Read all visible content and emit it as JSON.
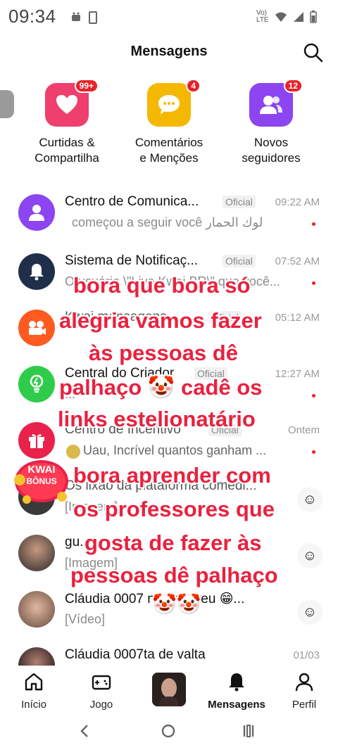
{
  "status_bar": {
    "time": "09:34",
    "network": "Vo) LTE"
  },
  "header": {
    "title": "Mensagens"
  },
  "categories": [
    {
      "label": "Curtidas & Compartilha",
      "label_line1": "Curtidas &",
      "label_line2": "Compartilha",
      "badge": "99+",
      "color": "#ee3f6e",
      "icon": "heart-icon"
    },
    {
      "label": "Comentários e Menções",
      "label_line1": "Comentários",
      "label_line2": "e Menções",
      "badge": "4",
      "color": "#f5b800",
      "icon": "chat-bubble-icon"
    },
    {
      "label": "Novos seguidores",
      "label_line1": "Novos",
      "label_line2": "seguidores",
      "badge": "12",
      "color": "#8c45f0",
      "icon": "users-icon"
    }
  ],
  "messages": [
    {
      "name": "Centro de Comunica...",
      "tag": "Oficial",
      "time": "09:22 AM",
      "preview": "começou a seguir você لوك الحمار",
      "unread": true,
      "avatar_color": "#8c45f0",
      "avatar_icon": "person-icon"
    },
    {
      "name": "Sistema de Notificaç...",
      "tag": "Oficial",
      "time": "07:52 AM",
      "preview": "O usuário \\\"Live Kwai BR\\\" que você...",
      "unread": true,
      "avatar_color": "#1f2f4a",
      "avatar_icon": "bell-icon"
    },
    {
      "name": "Kwai mensagens",
      "tag": "Oficial",
      "time": "05:12 AM",
      "preview": "",
      "unread": false,
      "avatar_color": "#ff5a1f",
      "avatar_icon": "camera-icon"
    },
    {
      "name": "Central do Criador",
      "tag": "Oficial",
      "time": "12:27 AM",
      "preview": "...",
      "unread": true,
      "avatar_color": "#2ecc4a",
      "avatar_icon": "bulb-icon"
    },
    {
      "name": "Centro de Incentivo",
      "tag": "Oficial",
      "time": "Ontem",
      "preview": "Uau, Incrível quantos ganham ...",
      "unread": true,
      "avatar_color": "#e8224a",
      "avatar_icon": "gift-icon"
    },
    {
      "name": "Os lixão da plataforma comedi...",
      "tag": "",
      "time": "",
      "preview": "[Imagem]",
      "unread": false,
      "avatar_color": "#3a3a3a",
      "avatar_icon": "photo-avatar"
    },
    {
      "name": "gu...",
      "tag": "",
      "time": "",
      "preview": "[Imagem]",
      "unread": false,
      "avatar_color": "#5a4a44",
      "avatar_icon": "photo-avatar"
    },
    {
      "name": "Cláudia 0007 não morreu 😁...",
      "tag": "",
      "time": "",
      "preview": "[Vídeo]",
      "unread": false,
      "avatar_color": "#8a6a5a",
      "avatar_icon": "photo-avatar"
    },
    {
      "name": "Cláudia 0007ta de valta",
      "tag": "",
      "time": "01/03",
      "preview": "[...]",
      "unread": false,
      "avatar_color": "#3a2a2a",
      "avatar_icon": "photo-avatar"
    }
  ],
  "overlay_text": [
    "bora que bora só",
    "alegria vamos fazer",
    "às pessoas dê",
    "palhaço 🤡 cadê os",
    "links estelionatário",
    "bora aprender com",
    "os professores que",
    "gosta de fazer às",
    "pessoas dê palhaço",
    "🤡🤡"
  ],
  "kwai_bonus": {
    "line1": "KWAI",
    "line2": "BÔNUS"
  },
  "bottom_nav": [
    {
      "label": "Início",
      "icon": "home-icon"
    },
    {
      "label": "Jogo",
      "icon": "gamepad-icon"
    },
    {
      "label": "",
      "icon": "profile-avatar"
    },
    {
      "label": "Mensagens",
      "icon": "bell-icon",
      "active": true
    },
    {
      "label": "Perfil",
      "icon": "person-icon"
    }
  ],
  "colors": {
    "accent_red": "#e8223f",
    "badge_red": "#e8222a"
  }
}
